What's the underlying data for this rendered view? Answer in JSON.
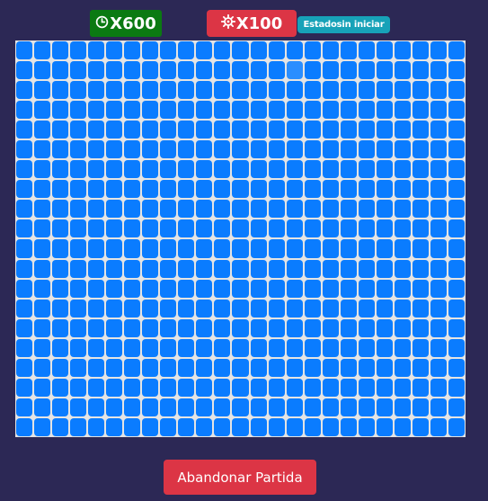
{
  "header": {
    "timer_label": "X600",
    "timer_icon": "clock-icon",
    "mines_label": "X100",
    "mines_icon": "mine-icon",
    "state_label": "Estadosin iniciar",
    "colors": {
      "timer_bg": "#0b7a12",
      "mines_bg": "#dc3545",
      "state_bg": "#17a2b8"
    }
  },
  "board": {
    "columns": 25,
    "rows": 20,
    "cell_color": "#0a7cff",
    "hovered_cell": {
      "row": 1,
      "col": 15
    }
  },
  "footer": {
    "abandon_label": "Abandonar Partida"
  }
}
